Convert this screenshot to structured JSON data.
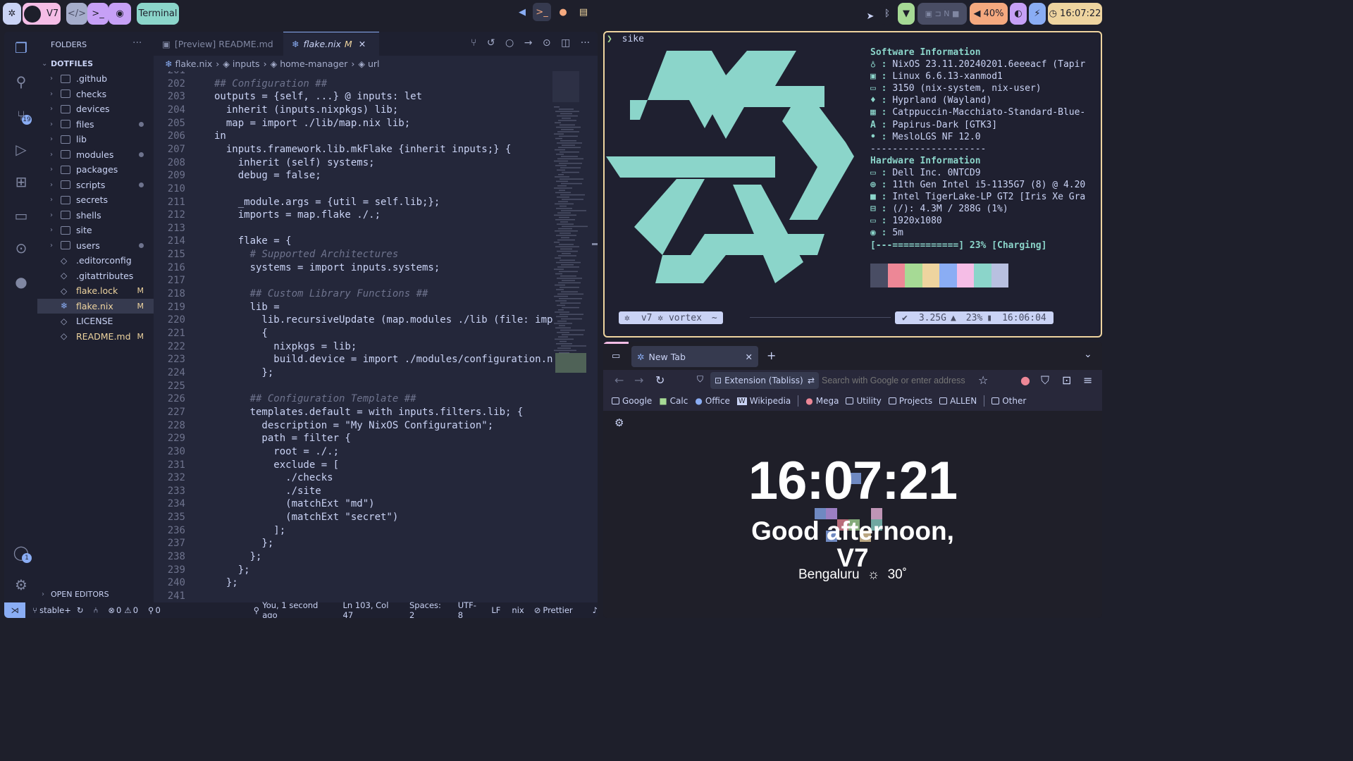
{
  "topbar": {
    "workspace_label": "V7",
    "terminal_pill": "Terminal",
    "battery": "40%",
    "clock": "16:07:22",
    "network_indicator": "N"
  },
  "vscode": {
    "sidebar_title": "FOLDERS",
    "root_folder": "DOTFILES",
    "files": [
      {
        "name": ".github",
        "type": "folder",
        "mark": ""
      },
      {
        "name": "checks",
        "type": "folder",
        "mark": ""
      },
      {
        "name": "devices",
        "type": "folder",
        "mark": ""
      },
      {
        "name": "files",
        "type": "folder",
        "mark": "dot"
      },
      {
        "name": "lib",
        "type": "folder",
        "mark": ""
      },
      {
        "name": "modules",
        "type": "folder",
        "mark": "dot"
      },
      {
        "name": "packages",
        "type": "folder",
        "mark": ""
      },
      {
        "name": "scripts",
        "type": "folder",
        "mark": "dot"
      },
      {
        "name": "secrets",
        "type": "folder",
        "mark": ""
      },
      {
        "name": "shells",
        "type": "folder",
        "mark": ""
      },
      {
        "name": "site",
        "type": "folder",
        "mark": ""
      },
      {
        "name": "users",
        "type": "folder",
        "mark": "dot"
      },
      {
        "name": ".editorconfig",
        "type": "file",
        "mark": ""
      },
      {
        "name": ".gitattributes",
        "type": "file",
        "mark": ""
      },
      {
        "name": "flake.lock",
        "type": "file",
        "mark": "M"
      },
      {
        "name": "flake.nix",
        "type": "file",
        "mark": "M"
      },
      {
        "name": "LICENSE",
        "type": "file",
        "mark": ""
      },
      {
        "name": "README.md",
        "type": "file",
        "mark": "M"
      }
    ],
    "open_editors": "OPEN EDITORS",
    "scm_badge": "19",
    "accounts_badge": "1",
    "tabs": [
      {
        "label": "[Preview] README.md",
        "marker": ""
      },
      {
        "label": "flake.nix",
        "marker": "M"
      }
    ],
    "breadcrumbs": [
      "flake.nix",
      "inputs",
      "home-manager",
      "url"
    ],
    "status": {
      "branch": "stable+",
      "errors": "0",
      "warnings": "0",
      "ports": "0",
      "blame": "You, 1 second ago",
      "position": "Ln 103, Col 47",
      "spaces": "Spaces: 2",
      "encoding": "UTF-8",
      "eol": "LF",
      "language": "nix",
      "formatter": "Prettier"
    }
  },
  "code_lines": [
    {
      "n": "201",
      "t": ""
    },
    {
      "n": "202",
      "t": "## Configuration ##"
    },
    {
      "n": "203",
      "t": "outputs = {self, ...} @ inputs: let"
    },
    {
      "n": "204",
      "t": "  inherit (inputs.nixpkgs) lib;"
    },
    {
      "n": "205",
      "t": "  map = import ./lib/map.nix lib;"
    },
    {
      "n": "206",
      "t": "in"
    },
    {
      "n": "207",
      "t": "  inputs.framework.lib.mkFlake {inherit inputs;} {"
    },
    {
      "n": "208",
      "t": "    inherit (self) systems;"
    },
    {
      "n": "209",
      "t": "    debug = false;"
    },
    {
      "n": "210",
      "t": ""
    },
    {
      "n": "211",
      "t": "    _module.args = {util = self.lib;};"
    },
    {
      "n": "212",
      "t": "    imports = map.flake ./.;"
    },
    {
      "n": "213",
      "t": ""
    },
    {
      "n": "214",
      "t": "    flake = {"
    },
    {
      "n": "215",
      "t": "      # Supported Architectures"
    },
    {
      "n": "216",
      "t": "      systems = import inputs.systems;"
    },
    {
      "n": "217",
      "t": ""
    },
    {
      "n": "218",
      "t": "      ## Custom Library Functions ##"
    },
    {
      "n": "219",
      "t": "      lib ="
    },
    {
      "n": "220",
      "t": "        lib.recursiveUpdate (map.modules ./lib (file: import fil"
    },
    {
      "n": "221",
      "t": "        {"
    },
    {
      "n": "222",
      "t": "          nixpkgs = lib;"
    },
    {
      "n": "223",
      "t": "          build.device = import ./modules/configuration.nix inh"
    },
    {
      "n": "224",
      "t": "        };"
    },
    {
      "n": "225",
      "t": ""
    },
    {
      "n": "226",
      "t": "      ## Configuration Template ##"
    },
    {
      "n": "227",
      "t": "      templates.default = with inputs.filters.lib; {"
    },
    {
      "n": "228",
      "t": "        description = \"My NixOS Configuration\";"
    },
    {
      "n": "229",
      "t": "        path = filter {"
    },
    {
      "n": "230",
      "t": "          root = ./.;"
    },
    {
      "n": "231",
      "t": "          exclude = ["
    },
    {
      "n": "232",
      "t": "            ./checks"
    },
    {
      "n": "233",
      "t": "            ./site"
    },
    {
      "n": "234",
      "t": "            (matchExt \"md\")"
    },
    {
      "n": "235",
      "t": "            (matchExt \"secret\")"
    },
    {
      "n": "236",
      "t": "          ];"
    },
    {
      "n": "237",
      "t": "        };"
    },
    {
      "n": "238",
      "t": "      };"
    },
    {
      "n": "239",
      "t": "    };"
    },
    {
      "n": "240",
      "t": "  };"
    },
    {
      "n": "241",
      "t": ""
    }
  ],
  "terminal": {
    "prompt": "sike",
    "sections": [
      {
        "key": "Software Information",
        "header": true
      },
      {
        "key": "",
        "val": "NixOS 23.11.20240201.6eeeacf (Tapir"
      },
      {
        "key": "",
        "val": "Linux 6.6.13-xanmod1"
      },
      {
        "key": "",
        "val": "3150 (nix-system, nix-user)"
      },
      {
        "key": "",
        "val": "Hyprland (Wayland)"
      },
      {
        "key": "",
        "val": "Catppuccin-Macchiato-Standard-Blue-"
      },
      {
        "key": "",
        "val": "Papirus-Dark [GTK3]"
      },
      {
        "key": "",
        "val": "MesloLGS NF 12.0"
      },
      {
        "key": "---------------------",
        "sep": true
      },
      {
        "key": "Hardware Information",
        "header": true
      },
      {
        "key": "",
        "val": "Dell Inc. 0NTCD9"
      },
      {
        "key": "",
        "val": "11th Gen Intel i5-1135G7 (8) @ 4.20"
      },
      {
        "key": "",
        "val": "Intel TigerLake-LP GT2 [Iris Xe Gra"
      },
      {
        "key": "",
        "val": "(/): 4.3M / 288G (1%)"
      },
      {
        "key": "",
        "val": "1920x1080"
      },
      {
        "key": "",
        "val": "5m"
      }
    ],
    "battery_bar": "[---============] 23% [Charging]",
    "palette": [
      "#494d64",
      "#ed8796",
      "#a6da95",
      "#eed49f",
      "#8aadf4",
      "#f5bde6",
      "#8bd5ca",
      "#b8c0e0"
    ],
    "prompt_left": "v7 ✲ vortex",
    "prompt_tilde": "~",
    "prompt_mem": "3.25G",
    "prompt_bat": "23%",
    "prompt_time": "16:06:04"
  },
  "browser": {
    "tab_title": "New Tab",
    "extension_label": "Extension (Tabliss)",
    "address_placeholder": "Search with Google or enter address",
    "bookmarks": [
      "Google",
      "Calc",
      "Office",
      "Wikipedia",
      "Mega",
      "Utility",
      "Projects",
      "ALLEN",
      "Other"
    ],
    "clock": "16:07:21",
    "greeting": "Good afternoon,",
    "name": "V7",
    "city": "Bengaluru",
    "temp": "30˚"
  },
  "colors": {
    "accent": "#8bd5ca",
    "yellow": "#eed49f",
    "peach": "#f5a97f"
  }
}
